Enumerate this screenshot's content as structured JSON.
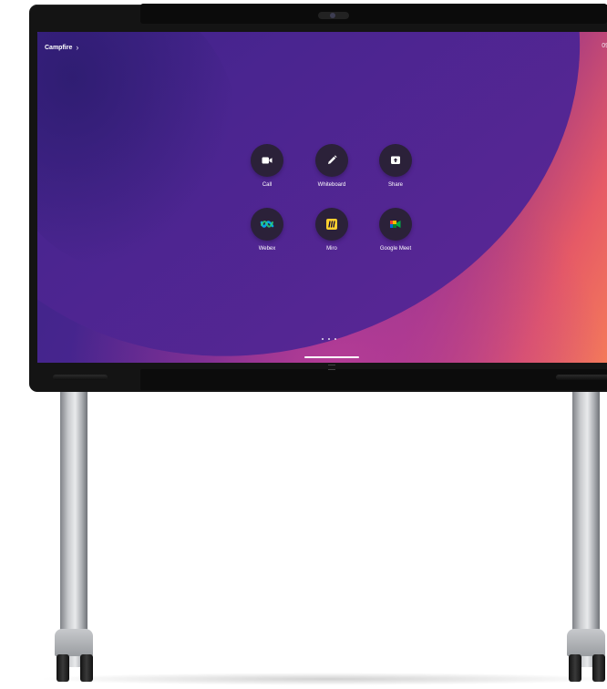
{
  "screen": {
    "location_label": "Campfire",
    "clock_partial": "09"
  },
  "apps": [
    {
      "label": "Call",
      "icon": "video-camera-icon"
    },
    {
      "label": "Whiteboard",
      "icon": "pencil-icon"
    },
    {
      "label": "Share",
      "icon": "share-upload-icon"
    },
    {
      "label": "Webex",
      "icon": "webex-logo-icon"
    },
    {
      "label": "Miro",
      "icon": "miro-logo-icon"
    },
    {
      "label": "Google Meet",
      "icon": "google-meet-logo-icon"
    }
  ],
  "pagination": {
    "page_count": 3,
    "current": 1
  },
  "colors": {
    "bezel": "#141414",
    "wallpaper_purple": "#4e2592",
    "wallpaper_coral": "#f47a5a",
    "app_button": "#2b2139",
    "miro_yellow": "#ffd02f",
    "webex_blue": "#07a3e6",
    "webex_green": "#2ad27a"
  }
}
